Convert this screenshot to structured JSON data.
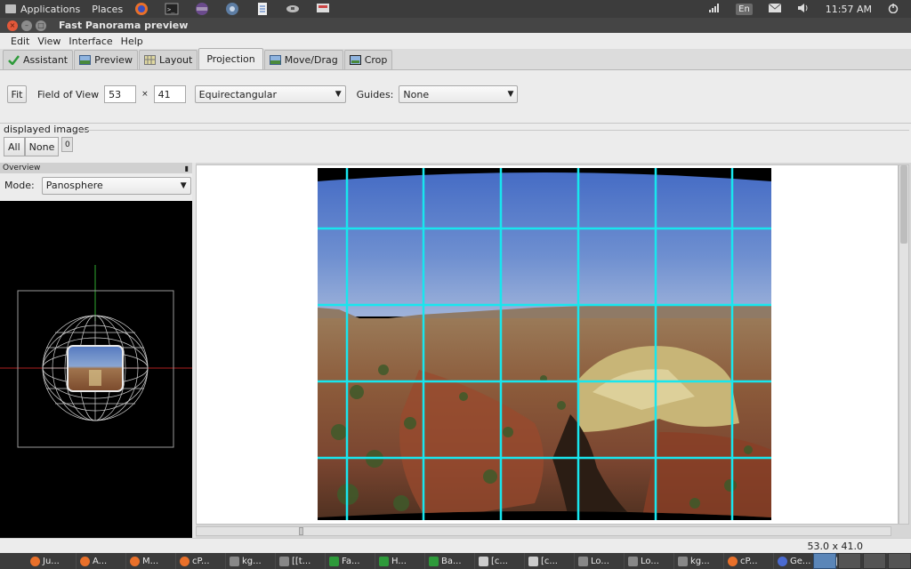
{
  "system": {
    "menu": [
      "Applications",
      "Places"
    ],
    "clock": "11:57 AM",
    "lang": "En",
    "launchers": [
      "firefox-icon",
      "terminal-icon",
      "eclipse-icon",
      "network-icon",
      "document-icon",
      "mouse-icon",
      "keyboard-icon"
    ]
  },
  "window": {
    "title": "Fast Panorama preview",
    "menus": [
      "Edit",
      "View",
      "Interface",
      "Help"
    ],
    "tabs": [
      {
        "label": "Assistant",
        "icon": "assistant-icon",
        "color": "#2e9a3a"
      },
      {
        "label": "Preview",
        "icon": "preview-icon",
        "color": "#4a78b8"
      },
      {
        "label": "Layout",
        "icon": "layout-icon",
        "color": "#8a8a52"
      },
      {
        "label": "Projection",
        "icon": "",
        "color": "",
        "active": true
      },
      {
        "label": "Move/Drag",
        "icon": "move-icon",
        "color": "#4a78b8"
      },
      {
        "label": "Crop",
        "icon": "crop-icon",
        "color": "#3a7bc0"
      }
    ]
  },
  "projection": {
    "fit_label": "Fit",
    "fov_label": "Field of View",
    "fov_h": "53",
    "fov_sep": "×",
    "fov_v": "41",
    "projection_type": "Equirectangular",
    "guides_label": "Guides:",
    "guides_value": "None"
  },
  "displayed_images": {
    "label": "displayed images",
    "all_label": "All",
    "none_label": "None",
    "image_index": "0"
  },
  "overview": {
    "title": "Overview",
    "mode_label": "Mode:",
    "mode_value": "Panosphere"
  },
  "status": {
    "fov_readout": "53.0 x 41.0"
  },
  "taskbar": {
    "items": [
      {
        "label": "Ju...",
        "color": "#e8702a"
      },
      {
        "label": "A...",
        "color": "#e8702a"
      },
      {
        "label": "M...",
        "color": "#e8702a"
      },
      {
        "label": "cP...",
        "color": "#e8702a"
      },
      {
        "label": "kg...",
        "color": "#888888"
      },
      {
        "label": "[[t...",
        "color": "#888888"
      },
      {
        "label": "Fa...",
        "color": "#2e9a3a"
      },
      {
        "label": "H...",
        "color": "#2e9a3a"
      },
      {
        "label": "Ba...",
        "color": "#2e9a3a"
      },
      {
        "label": "[c...",
        "color": "#cccccc"
      },
      {
        "label": "[c...",
        "color": "#cccccc"
      },
      {
        "label": "Lo...",
        "color": "#888888"
      },
      {
        "label": "Lo...",
        "color": "#888888"
      },
      {
        "label": "kg...",
        "color": "#888888"
      },
      {
        "label": "cP...",
        "color": "#e8702a"
      },
      {
        "label": "Ge...",
        "color": "#4a6ad0"
      },
      {
        "label": "[*[...",
        "color": "#cccccc"
      }
    ]
  }
}
